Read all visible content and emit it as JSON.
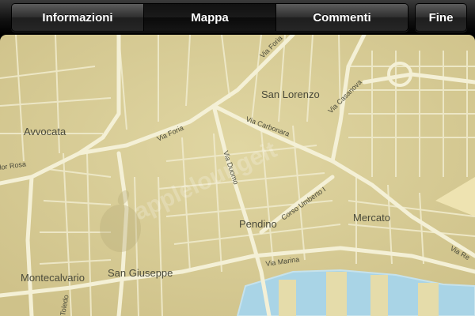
{
  "toolbar": {
    "tabs": [
      {
        "label": "Informazioni",
        "active": false
      },
      {
        "label": "Mappa",
        "active": true
      },
      {
        "label": "Commenti",
        "active": false
      }
    ],
    "done_label": "Fine"
  },
  "map": {
    "districts": {
      "avvocata": "Avvocata",
      "san_lorenzo": "San Lorenzo",
      "pendino": "Pendino",
      "mercato": "Mercato",
      "san_giuseppe": "San Giuseppe",
      "montecalvario": "Montecalvario"
    },
    "streets": {
      "via_foria_top": "Via Foria",
      "via_foria": "Via Foria",
      "via_carbonara": "Via Carbonara",
      "via_casanova": "Via Casanova",
      "via_duomo": "Via Duomo",
      "corso_umberto": "Corso Umberto I",
      "via_marina": "Via Marina",
      "via_reggia": "Via Re",
      "salvator_rosa": "lor Rosa",
      "via_toledo": "Toledo"
    },
    "watermark": "appleloungeit",
    "colors": {
      "land": "#d9cf98",
      "road": "#f2eed0",
      "water": "#a9d4e6"
    }
  }
}
